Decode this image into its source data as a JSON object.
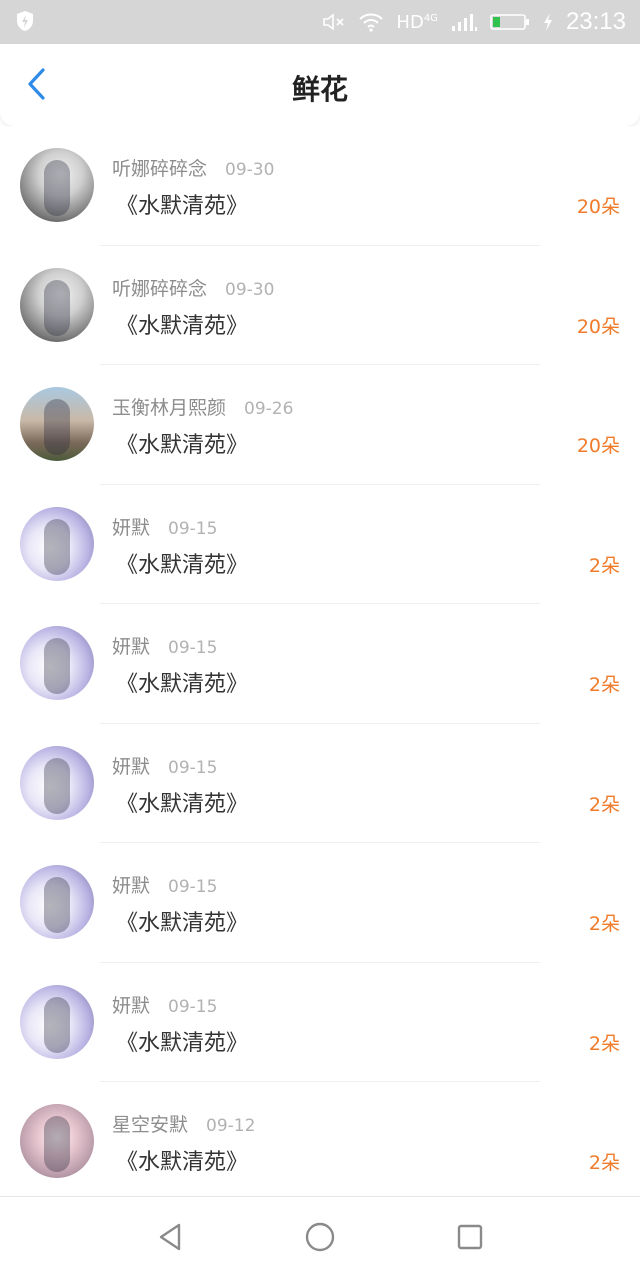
{
  "status_bar": {
    "network": "HD",
    "network_type": "4G",
    "time": "23:13",
    "icons": [
      "shield-bolt-icon",
      "mute-icon",
      "wifi-icon",
      "signal-icon",
      "battery-icon",
      "charging-icon"
    ]
  },
  "header": {
    "title": "鲜花",
    "back_icon": "chevron-left-icon",
    "accent_color": "#2f8bea"
  },
  "records": [
    {
      "name": "听娜碎碎念",
      "date": "09-30",
      "book": "《水默清苑》",
      "count": "20朵"
    },
    {
      "name": "听娜碎碎念",
      "date": "09-30",
      "book": "《水默清苑》",
      "count": "20朵"
    },
    {
      "name": "玉衡林月熙颜",
      "date": "09-26",
      "book": "《水默清苑》",
      "count": "20朵"
    },
    {
      "name": "妍默",
      "date": "09-15",
      "book": "《水默清苑》",
      "count": "2朵"
    },
    {
      "name": "妍默",
      "date": "09-15",
      "book": "《水默清苑》",
      "count": "2朵"
    },
    {
      "name": "妍默",
      "date": "09-15",
      "book": "《水默清苑》",
      "count": "2朵"
    },
    {
      "name": "妍默",
      "date": "09-15",
      "book": "《水默清苑》",
      "count": "2朵"
    },
    {
      "name": "妍默",
      "date": "09-15",
      "book": "《水默清苑》",
      "count": "2朵"
    },
    {
      "name": "星空安默",
      "date": "09-12",
      "book": "《水默清苑》",
      "count": "2朵"
    }
  ],
  "count_color": "#f07b2a",
  "system_nav": {
    "icons": [
      "back-triangle-icon",
      "home-circle-icon",
      "recents-square-icon"
    ]
  }
}
